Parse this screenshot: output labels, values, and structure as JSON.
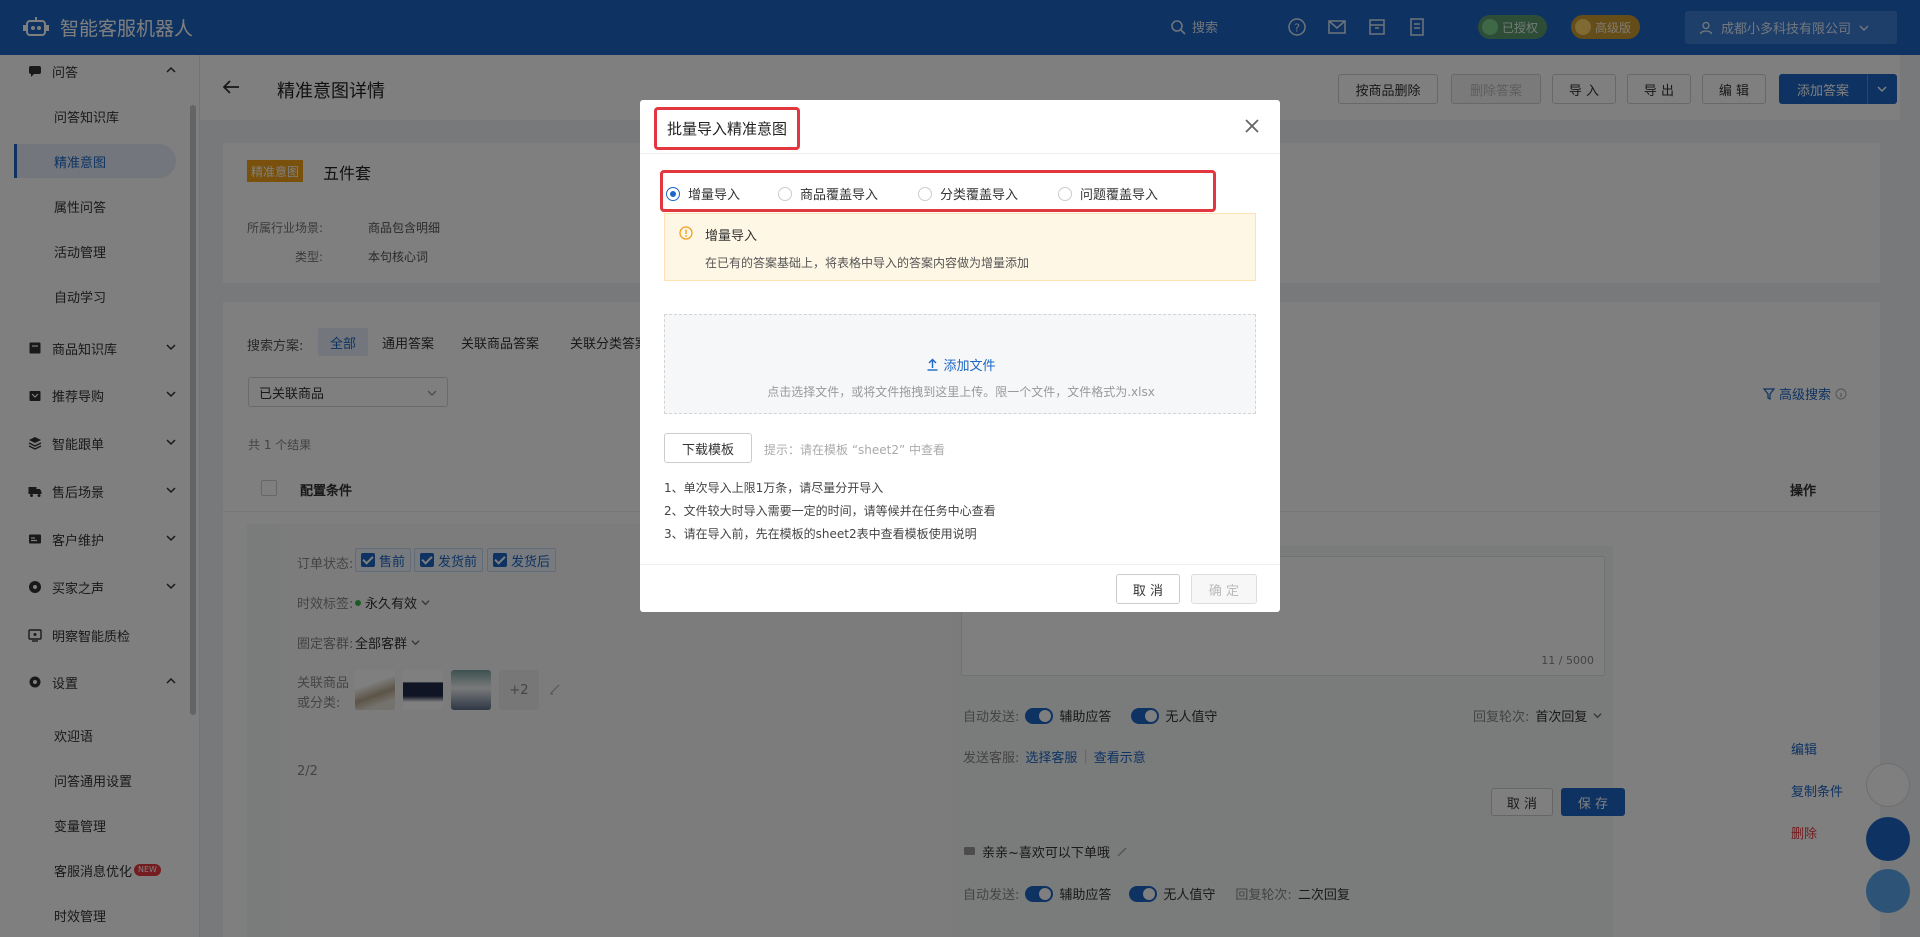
{
  "app": {
    "title": "智能客服机器人"
  },
  "topbar": {
    "search_label": "搜索",
    "authorized_badge": "已授权",
    "edition_badge": "高级版",
    "company": "成都小多科技有限公司",
    "icons": [
      "help-icon",
      "mail-icon",
      "archive-icon",
      "document-icon"
    ]
  },
  "sidebar": {
    "groups": [
      {
        "label": "问答",
        "icon": "chat-icon",
        "expanded": true
      },
      {
        "label": "商品知识库",
        "icon": "box-icon"
      },
      {
        "label": "推荐导购",
        "icon": "bag-icon"
      },
      {
        "label": "智能跟单",
        "icon": "layers-icon"
      },
      {
        "label": "售后场景",
        "icon": "truck-icon"
      },
      {
        "label": "客户维护",
        "icon": "id-card-icon"
      },
      {
        "label": "买家之声",
        "icon": "speech-icon"
      },
      {
        "label": "明察智能质检",
        "icon": "monitor-icon"
      },
      {
        "label": "设置",
        "icon": "gear-icon",
        "expanded": true
      }
    ],
    "qa_items": [
      "问答知识库",
      "精准意图",
      "属性问答",
      "活动管理",
      "自动学习"
    ],
    "settings_items": [
      "欢迎语",
      "问答通用设置",
      "变量管理",
      "客服消息优化",
      "时效管理"
    ],
    "new_tag": "NEW"
  },
  "header": {
    "title": "精准意图详情",
    "buttons": {
      "delete_by_product": "按商品删除",
      "delete_answer": "删除答案",
      "import": "导 入",
      "export": "导 出",
      "edit": "编 辑",
      "add_answer": "添加答案"
    }
  },
  "intent": {
    "tag": "精准意图",
    "name": "五件套",
    "industry_label": "所属行业场景:",
    "industry_value": "商品包含明细",
    "type_label": "类型:",
    "type_value": "本句核心词"
  },
  "filters": {
    "scheme_label": "搜索方案:",
    "tabs": [
      "全部",
      "通用答案",
      "关联商品答案",
      "关联分类答案"
    ],
    "select_value": "已关联商品",
    "advanced_search": "高级搜索",
    "result_count": "共 1 个结果"
  },
  "table": {
    "col_condition": "配置条件",
    "col_ops": "操作"
  },
  "row": {
    "order_status_label": "订单状态:",
    "order_tags": [
      "售前",
      "发货前",
      "发货后"
    ],
    "timing_label": "时效标签:",
    "timing_value": "永久有效",
    "group_label": "圈定客群:",
    "group_value": "全部客群",
    "product_label_line1": "关联商品",
    "product_label_line2": "或分类:",
    "more_products": "+2",
    "pager": "2/2",
    "answer_count": "11 / 5000",
    "auto_send_label": "自动发送:",
    "assist_label": "辅助应答",
    "unattended_label": "无人值守",
    "round_label": "回复轮次:",
    "round_value": "首次回复",
    "send_agent_label": "发送客服:",
    "select_agent": "选择客服",
    "view_example": "查看示意",
    "cancel": "取 消",
    "save": "保 存",
    "second_answer": "亲亲~喜欢可以下单哦",
    "second_round_value": "二次回复"
  },
  "ops": {
    "edit": "编辑",
    "copy": "复制条件",
    "delete": "删除"
  },
  "modal": {
    "title": "批量导入精准意图",
    "options": [
      "增量导入",
      "商品覆盖导入",
      "分类覆盖导入",
      "问题覆盖导入"
    ],
    "selected_index": 0,
    "alert_title": "增量导入",
    "alert_desc": "在已有的答案基础上，将表格中导入的答案内容做为增量添加",
    "add_file": "添加文件",
    "upload_hint": "点击选择文件，或将文件拖拽到这里上传。限一个文件，文件格式为.xlsx",
    "download_template": "下载模板",
    "template_tip": "提示：请在模板 “sheet2” 中查看",
    "notes": [
      "1、单次导入上限1万条，请尽量分开导入",
      "2、文件较大时导入需要一定的时间，请等候并在任务中心查看",
      "3、请在导入前，先在模板的sheet2表中查看模板使用说明"
    ],
    "cancel": "取 消",
    "confirm": "确 定"
  },
  "colors": {
    "primary": "#1c66c4",
    "highlight": "#e2373f",
    "warn_bg": "#fff7e6",
    "intent_tag": "#f2a318"
  }
}
